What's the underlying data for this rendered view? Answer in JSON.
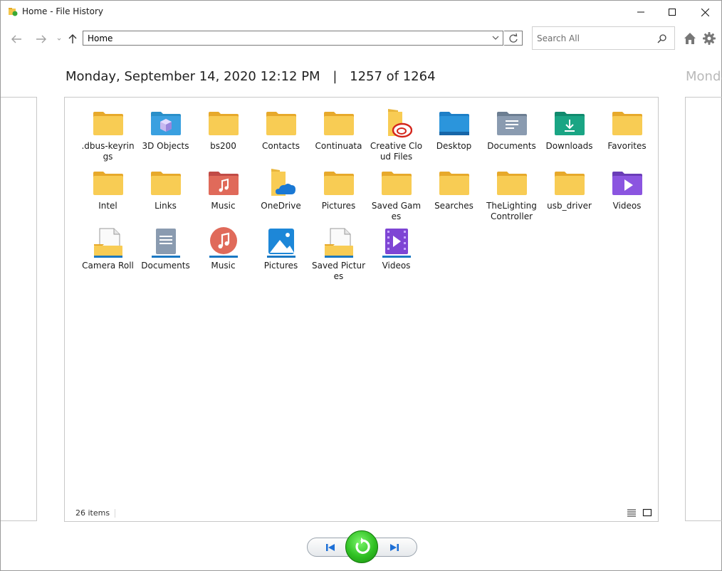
{
  "window": {
    "title": "Home - File History"
  },
  "toolbar": {
    "back_icon": "arrow-left-icon",
    "forward_icon": "arrow-right-icon",
    "up_icon": "arrow-up-icon",
    "address": "Home",
    "search_placeholder": "Search All"
  },
  "header": {
    "datetime": "Monday, September 14, 2020 12:12 PM",
    "separator": "|",
    "position": "1257 of 1264",
    "next_datetime": "Monda"
  },
  "items": [
    {
      "label": ".dbus-keyrings",
      "icon": "folder-icon"
    },
    {
      "label": "3D Objects",
      "icon": "3d-objects-folder-icon"
    },
    {
      "label": "bs200",
      "icon": "folder-icon"
    },
    {
      "label": "Contacts",
      "icon": "folder-icon"
    },
    {
      "label": "Continuata",
      "icon": "folder-icon"
    },
    {
      "label": "Creative Cloud Files",
      "icon": "creative-cloud-folder-icon"
    },
    {
      "label": "Desktop",
      "icon": "desktop-folder-icon"
    },
    {
      "label": "Documents",
      "icon": "documents-folder-icon"
    },
    {
      "label": "Downloads",
      "icon": "downloads-folder-icon"
    },
    {
      "label": "Favorites",
      "icon": "folder-icon"
    },
    {
      "label": "Intel",
      "icon": "folder-icon"
    },
    {
      "label": "Links",
      "icon": "folder-icon"
    },
    {
      "label": "Music",
      "icon": "music-folder-icon"
    },
    {
      "label": "OneDrive",
      "icon": "onedrive-folder-icon"
    },
    {
      "label": "Pictures",
      "icon": "folder-icon"
    },
    {
      "label": "Saved Games",
      "icon": "folder-icon"
    },
    {
      "label": "Searches",
      "icon": "folder-icon"
    },
    {
      "label": "TheLightingController",
      "icon": "folder-icon"
    },
    {
      "label": "usb_driver",
      "icon": "folder-icon"
    },
    {
      "label": "Videos",
      "icon": "videos-folder-icon"
    },
    {
      "label": "Camera Roll",
      "icon": "camera-roll-library-icon"
    },
    {
      "label": "Documents",
      "icon": "documents-library-icon"
    },
    {
      "label": "Music",
      "icon": "music-library-icon"
    },
    {
      "label": "Pictures",
      "icon": "pictures-library-icon"
    },
    {
      "label": "Saved Pictures",
      "icon": "saved-pictures-library-icon"
    },
    {
      "label": "Videos",
      "icon": "videos-library-icon"
    }
  ],
  "status": {
    "count": "26 items"
  },
  "colors": {
    "folder": "#f8cc54",
    "folder_dark": "#e7a92b",
    "restore": "#2fbf22",
    "nav_blue": "#1d6fd6"
  }
}
